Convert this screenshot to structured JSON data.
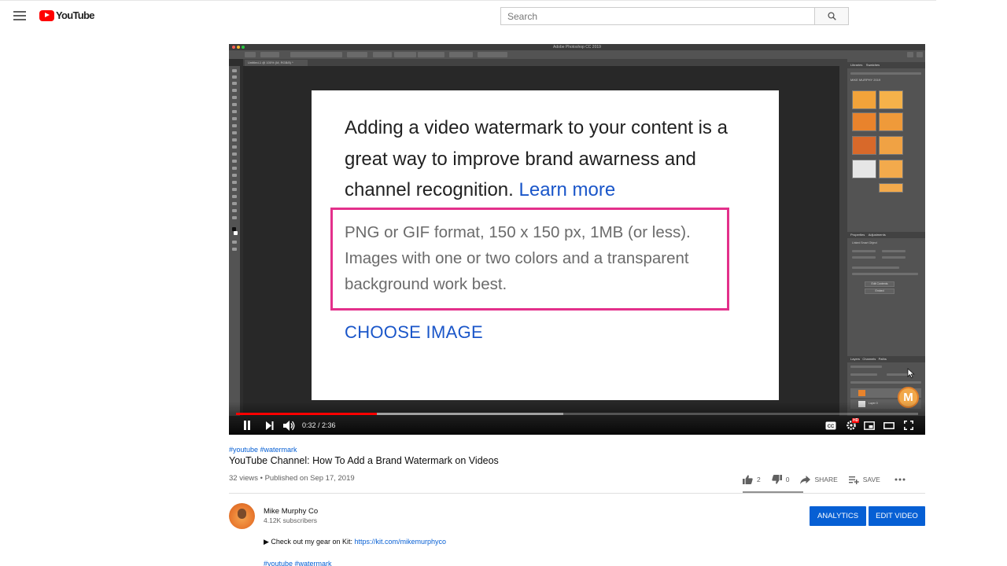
{
  "header": {
    "logo_text": "YouTube",
    "search_placeholder": "Search"
  },
  "photoshop": {
    "app_title": "Adobe Photoshop CC 2019",
    "document_tab": "Untitled-1 @ 100% (M, RGB/8) *",
    "panel_libraries": "Libraries",
    "panel_swatches": "Swatches",
    "library_name": "MIKE MURPHY 2019",
    "panel_properties": "Properties",
    "panel_adjustments": "Adjustments",
    "linked_object": "Linked Smart Object",
    "btn_edit_contents": "Edit Contents",
    "btn_embed": "Embed",
    "panel_layers": "Layers",
    "panel_channels": "Channels",
    "panel_paths": "Paths",
    "layer_0": "Layer 0"
  },
  "slide": {
    "text_line": "Adding a video watermark to your content is a great way to improve brand awarness and channel recognition.",
    "learn_more": "Learn more",
    "specs": "PNG or GIF format, 150 x 150 px, 1MB (or less). Images with one or two colors and a transparent background work best.",
    "choose_image": "CHOOSE IMAGE"
  },
  "player": {
    "time": "0:32 / 2:36",
    "progress_played": 0.206,
    "progress_buffered": 0.48,
    "hd_badge": "HD",
    "colors": {
      "progress": "#ff0000",
      "watermark_box": "#e3308b"
    }
  },
  "video": {
    "hashtags": "#youtube #watermark",
    "title": "YouTube Channel: How To Add a Brand Watermark on Videos",
    "meta": "32 views • Published on Sep 17, 2019",
    "likes": "2",
    "dislikes": "0",
    "share_label": "SHARE",
    "save_label": "SAVE"
  },
  "channel": {
    "name": "Mike Murphy Co",
    "subscribers": "4.12K subscribers",
    "analytics_label": "ANALYTICS",
    "edit_label": "EDIT VIDEO"
  },
  "description": {
    "kit_text": "▶ Check out my gear on Kit:",
    "kit_link": "https://kit.com/mikemurphyco",
    "hashtags": "#youtube #watermark"
  },
  "colors": {
    "accent": "#065fd4",
    "brand_red": "#ff0000"
  }
}
